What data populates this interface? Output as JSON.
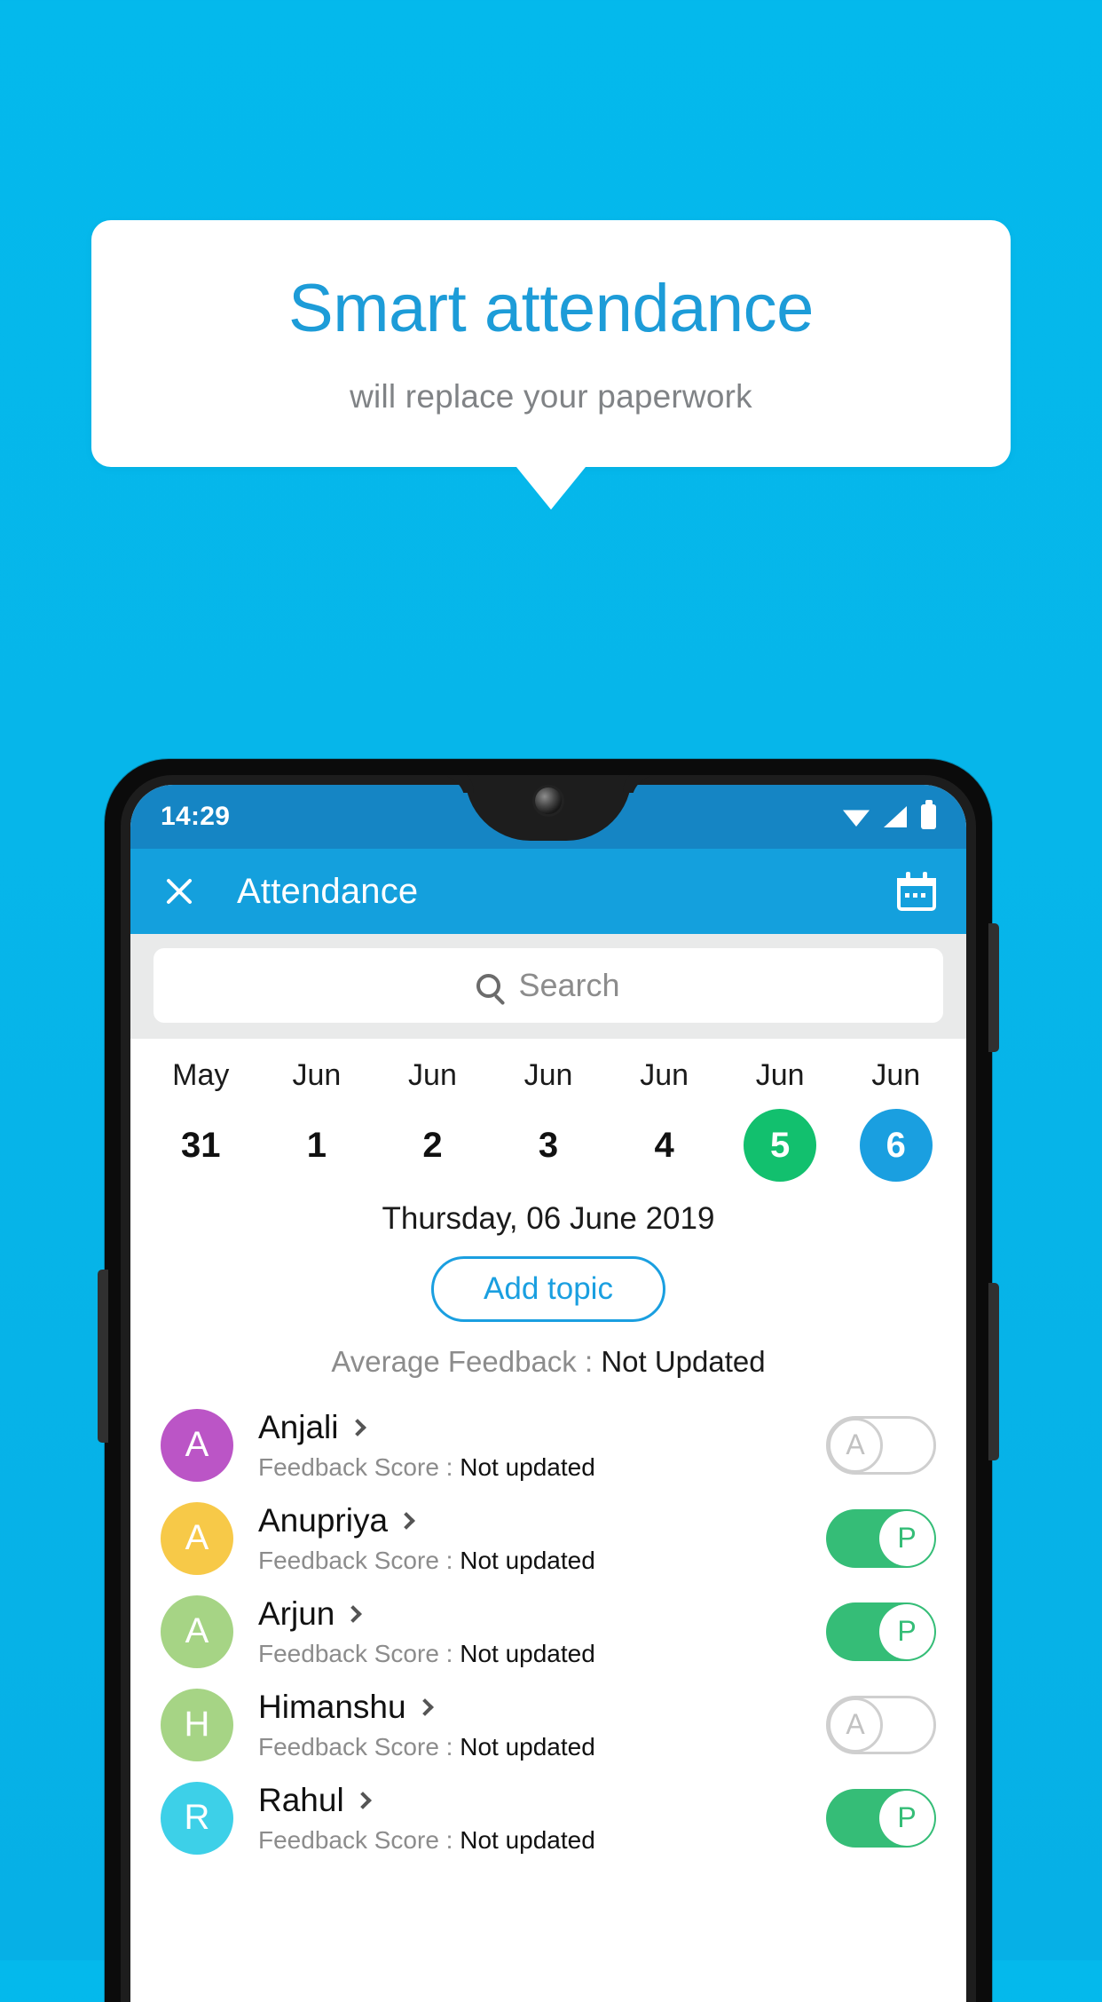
{
  "banner": {
    "title": "Smart attendance",
    "subtitle": "will replace your paperwork",
    "title_color": "#1d9cd8",
    "background_color": "#06b6ea"
  },
  "phone": {
    "statusbar": {
      "time": "14:29",
      "icons": [
        "wifi-icon",
        "signal-icon",
        "battery-icon"
      ],
      "background_color": "#1585c4"
    },
    "appbar": {
      "close_icon": "close-icon",
      "title": "Attendance",
      "calendar_icon": "calendar-icon",
      "background_color": "#14a0dd"
    },
    "search": {
      "icon": "search-icon",
      "placeholder": "Search"
    },
    "date_strip": [
      {
        "month": "May",
        "day": "31",
        "state": "normal"
      },
      {
        "month": "Jun",
        "day": "1",
        "state": "normal"
      },
      {
        "month": "Jun",
        "day": "2",
        "state": "normal"
      },
      {
        "month": "Jun",
        "day": "3",
        "state": "normal"
      },
      {
        "month": "Jun",
        "day": "4",
        "state": "normal"
      },
      {
        "month": "Jun",
        "day": "5",
        "state": "marked-green"
      },
      {
        "month": "Jun",
        "day": "6",
        "state": "selected-blue"
      }
    ],
    "selected_date_label": "Thursday, 06 June 2019",
    "add_topic_label": "Add topic",
    "average_feedback_label": "Average Feedback : ",
    "average_feedback_value": "Not Updated",
    "feedback_label": "Feedback Score : ",
    "students": [
      {
        "name": "Anjali",
        "initial": "A",
        "avatar_color": "#bb55c6",
        "feedback_value": "Not updated",
        "attendance": "A",
        "attendance_state": "absent"
      },
      {
        "name": "Anupriya",
        "initial": "A",
        "avatar_color": "#f7c948",
        "feedback_value": "Not updated",
        "attendance": "P",
        "attendance_state": "present"
      },
      {
        "name": "Arjun",
        "initial": "A",
        "avatar_color": "#a6d485",
        "feedback_value": "Not updated",
        "attendance": "P",
        "attendance_state": "present"
      },
      {
        "name": "Himanshu",
        "initial": "H",
        "avatar_color": "#a6d485",
        "feedback_value": "Not updated",
        "attendance": "A",
        "attendance_state": "absent"
      },
      {
        "name": "Rahul",
        "initial": "R",
        "avatar_color": "#3dd0e8",
        "feedback_value": "Not updated",
        "attendance": "P",
        "attendance_state": "present"
      }
    ]
  },
  "colors": {
    "accent_blue": "#1a9fe0",
    "green": "#12c06e",
    "toggle_green": "#35bd77",
    "background": "#06b6ea"
  }
}
